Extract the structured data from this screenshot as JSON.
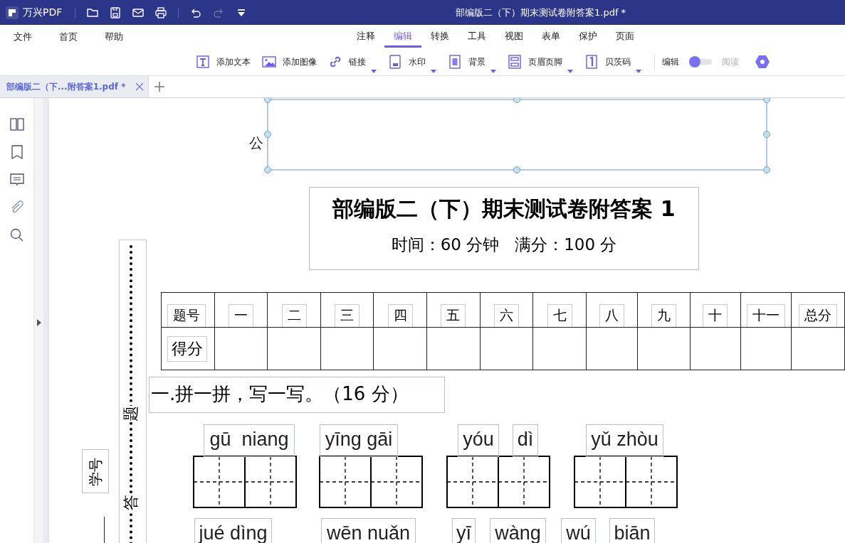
{
  "app": {
    "name": "万兴PDF"
  },
  "window": {
    "title": "部编版二（下）期末测试卷附答案1.pdf *"
  },
  "quick_actions": [
    {
      "kind": "open",
      "disabled": false
    },
    {
      "kind": "save",
      "disabled": false
    },
    {
      "kind": "mail",
      "disabled": false
    },
    {
      "kind": "print",
      "disabled": false
    },
    {
      "kind": "undo",
      "disabled": false
    },
    {
      "kind": "redo",
      "disabled": true
    },
    {
      "kind": "more",
      "disabled": false
    }
  ],
  "menu": [
    "文件",
    "首页",
    "帮助"
  ],
  "ribbon_tabs": [
    {
      "label": "注释",
      "selected": false
    },
    {
      "label": "编辑",
      "selected": true
    },
    {
      "label": "转换",
      "selected": false
    },
    {
      "label": "工具",
      "selected": false
    },
    {
      "label": "视图",
      "selected": false
    },
    {
      "label": "表单",
      "selected": false
    },
    {
      "label": "保护",
      "selected": false
    },
    {
      "label": "页面",
      "selected": false
    }
  ],
  "tools": [
    {
      "kind": "text",
      "label": "添加文本",
      "dropdown": false
    },
    {
      "kind": "image",
      "label": "添加图像",
      "dropdown": false
    },
    {
      "kind": "link",
      "label": "链接",
      "dropdown": true
    },
    {
      "kind": "watermark",
      "label": "水印",
      "dropdown": true
    },
    {
      "kind": "background",
      "label": "背景",
      "dropdown": true
    },
    {
      "kind": "header_footer",
      "label": "页眉页脚",
      "dropdown": true
    },
    {
      "kind": "bates",
      "label": "贝茨码",
      "dropdown": true
    }
  ],
  "mode": {
    "edit_label": "编辑",
    "read_label": "阅读",
    "read": false
  },
  "doc_tabs": [
    {
      "label": "部编版二（下...附答案1.pdf *",
      "selected": true
    }
  ],
  "page": {
    "cut_text": "公",
    "title": "部编版二（下）期末测试卷附答案 1",
    "subtitle": "时间：60 分钟   满分：100 分",
    "margin_marks": [
      "题",
      "答"
    ],
    "student_id_label": "学号",
    "score_table": {
      "header": [
        "题号",
        "一",
        "二",
        "三",
        "四",
        "五",
        "六",
        "七",
        "八",
        "九",
        "十",
        "十一",
        "总分"
      ],
      "row_label": "得分"
    },
    "section": "一.拼一拼，写一写。（16 分）",
    "pinyin": [
      "gū  niang",
      "yīng gāi",
      "yóu",
      "dì",
      "yǔ zhòu",
      "jué dìng",
      "wēn nuǎn",
      "yī",
      "wàng",
      "wú",
      "biān"
    ]
  }
}
